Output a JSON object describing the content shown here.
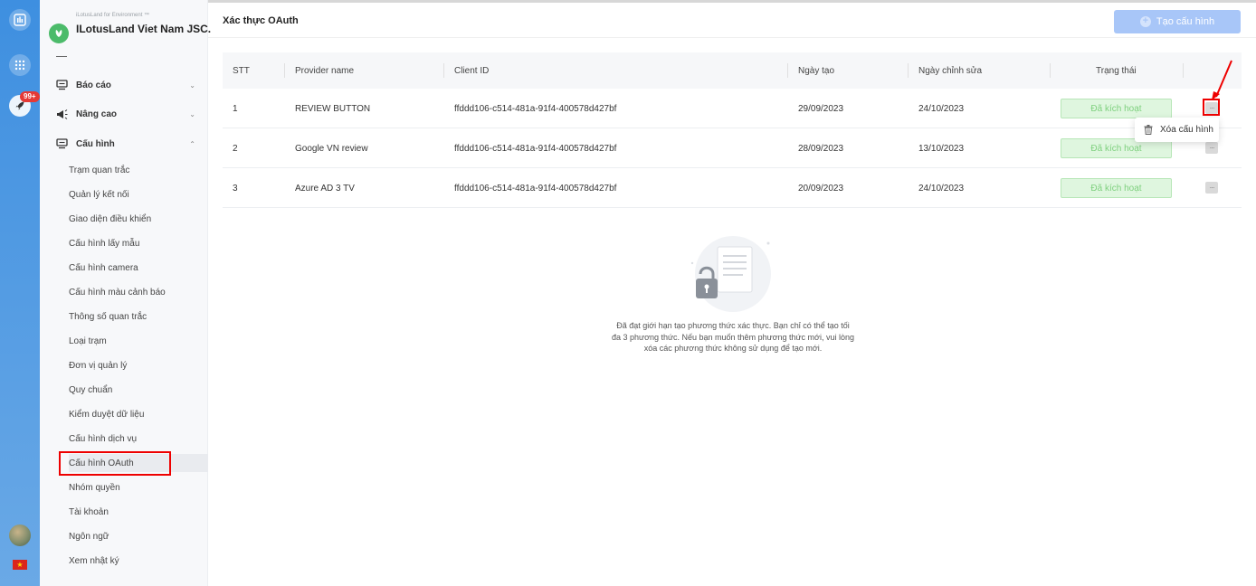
{
  "rail": {
    "badge": "99+"
  },
  "org": {
    "subtitle": "iLotusLand for Environment ™",
    "name": "ILotusLand Viet Nam JSC."
  },
  "nav": {
    "report": "Báo cáo",
    "advanced": "Nâng cao",
    "config": "Cấu hình",
    "sub_items": [
      "Trạm quan trắc",
      "Quản lý kết nối",
      "Giao diện điều khiển",
      "Cấu hình lấy mẫu",
      "Cấu hình camera",
      "Cấu hình màu cảnh báo",
      "Thông số quan trắc",
      "Loại trạm",
      "Đơn vị quản lý",
      "Quy chuẩn",
      "Kiểm duyệt dữ liệu",
      "Cấu hình dịch vụ",
      "Cấu hình OAuth",
      "Nhóm quyền",
      "Tài khoản",
      "Ngôn ngữ",
      "Xem nhật ký"
    ]
  },
  "page": {
    "title": "Xác thực OAuth",
    "create_button": "Tạo cấu hình"
  },
  "table": {
    "headers": [
      "STT",
      "Provider name",
      "Client ID",
      "Ngày tạo",
      "Ngày chỉnh sửa",
      "Trạng thái"
    ],
    "rows": [
      {
        "stt": "1",
        "provider": "REVIEW BUTTON",
        "client_id": "ffddd106-c514-481a-91f4-400578d427bf",
        "created": "29/09/2023",
        "modified": "24/10/2023",
        "status": "Đã kích hoạt"
      },
      {
        "stt": "2",
        "provider": "Google VN review",
        "client_id": "ffddd106-c514-481a-91f4-400578d427bf",
        "created": "28/09/2023",
        "modified": "13/10/2023",
        "status": "Đã kích hoạt"
      },
      {
        "stt": "3",
        "provider": "Azure AD 3 TV",
        "client_id": "ffddd106-c514-481a-91f4-400578d427bf",
        "created": "20/09/2023",
        "modified": "24/10/2023",
        "status": "Đã kích hoạt"
      }
    ],
    "more_glyph": "···"
  },
  "dropdown": {
    "delete_label": "Xóa cấu hình"
  },
  "empty_state": {
    "message": "Đã đạt giới hạn tạo phương thức xác thực. Bạn chỉ có thể tạo tối đa 3 phương thức. Nếu bạn muốn thêm phương thức mới, vui lòng xóa các phương thức không sử dụng để tạo mới."
  },
  "colors": {
    "rail": "#3e8fe0",
    "primary_button": "#a8c6f8",
    "status_bg": "#dff6df",
    "status_text": "#7ed07e",
    "highlight": "#ee0000"
  }
}
